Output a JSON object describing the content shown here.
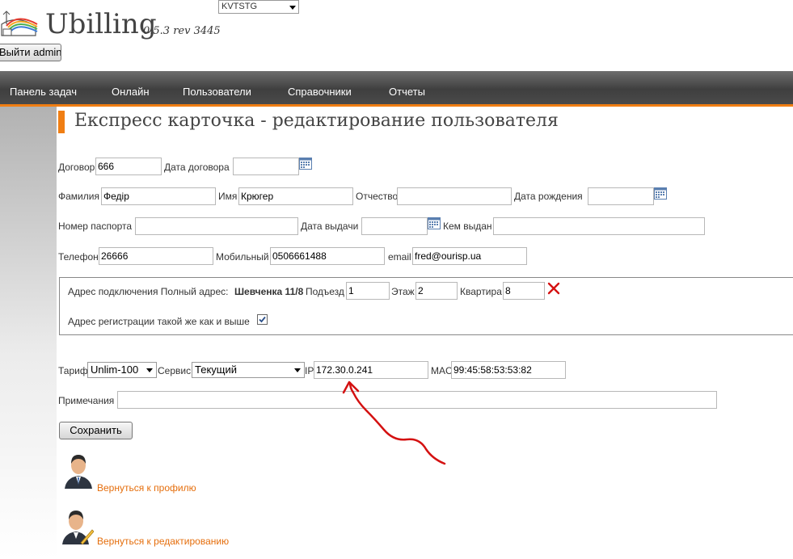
{
  "header": {
    "brand": "Ubilling",
    "version": "0.5.3 rev 3445",
    "locale_select": "KVTSTG",
    "logout_label": "Выйти admin"
  },
  "nav": {
    "items": [
      "Панель задач",
      "Онлайн",
      "Пользователи",
      "Справочники",
      "Отчеты"
    ]
  },
  "page": {
    "title": "Експресс карточка - редактирование пользователя"
  },
  "form": {
    "contract_label": "Договор",
    "contract_value": "666",
    "contract_date_label": "Дата договора",
    "contract_date_value": "",
    "surname_label": "Фамилия",
    "surname_value": "Федір",
    "name_label": "Имя",
    "name_value": "Крюгер",
    "patronymic_label": "Отчество",
    "patronymic_value": "",
    "birthdate_label": "Дата рождения",
    "birthdate_value": "",
    "passport_label": "Номер паспорта",
    "passport_value": "",
    "issue_date_label": "Дата выдачи",
    "issue_date_value": "",
    "issued_by_label": "Кем выдан",
    "issued_by_value": "",
    "phone_label": "Телефон",
    "phone_value": "26666",
    "mobile_label": "Мобильный",
    "mobile_value": "0506661488",
    "email_label": "email",
    "email_value": "fred@ourisp.ua",
    "address": {
      "prefix": "Адрес подключения Полный адрес:",
      "full_address": "Шевченка 11/8",
      "entrance_label": "Подъезд",
      "entrance_value": "1",
      "floor_label": "Этаж",
      "floor_value": "2",
      "apartment_label": "Квартира",
      "apartment_value": "8",
      "same_reg_label": "Адрес регистрации такой же как и выше",
      "same_reg_checked": true
    },
    "tariff_label": "Тариф",
    "tariff_value": "Unlim-100",
    "service_label": "Сервис",
    "service_value": "Текущий",
    "ip_label": "IP",
    "ip_value": "172.30.0.241",
    "mac_label": "MAC",
    "mac_value": "99:45:58:53:53:82",
    "notes_label": "Примечания",
    "notes_value": "",
    "save_label": "Сохранить"
  },
  "links": {
    "back_profile": "Вернуться к профилю",
    "back_edit": "Вернуться к редактированию"
  },
  "colors": {
    "accent": "#f07e13",
    "link": "#e56e0c",
    "annotation": "#d41111"
  }
}
